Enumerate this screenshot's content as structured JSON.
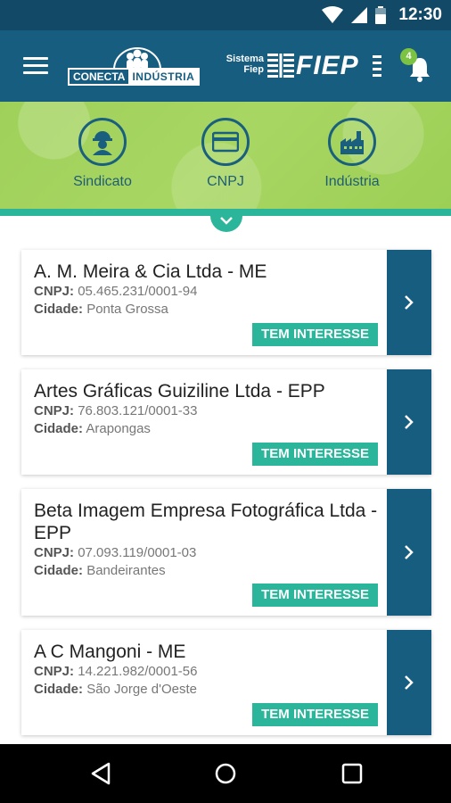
{
  "status_bar": {
    "time": "12:30"
  },
  "header": {
    "logo_conecta_left": "CONECTA",
    "logo_conecta_right": "INDÚSTRIA",
    "logo_sistema": "Sistema",
    "logo_fiep_small": "Fiep",
    "logo_fiep": "FIEP",
    "notification_count": "4"
  },
  "shortcuts": [
    {
      "label": "Sindicato",
      "icon": "worker-helmet-icon"
    },
    {
      "label": "CNPJ",
      "icon": "card-icon"
    },
    {
      "label": "Indústria",
      "icon": "factory-icon"
    }
  ],
  "list": {
    "cnpj_label": "CNPJ:",
    "city_label": "Cidade:",
    "interest_label": "TEM INTERESSE",
    "items": [
      {
        "name": "A. M. Meira & Cia Ltda - ME",
        "cnpj": "05.465.231/0001-94",
        "city": "Ponta Grossa"
      },
      {
        "name": "Artes Gráficas Guiziline Ltda - EPP",
        "cnpj": "76.803.121/0001-33",
        "city": "Arapongas"
      },
      {
        "name": "Beta Imagem Empresa Fotográfica Ltda - EPP",
        "cnpj": "07.093.119/0001-03",
        "city": "Bandeirantes"
      },
      {
        "name": "A C Mangoni - ME",
        "cnpj": "14.221.982/0001-56",
        "city": "São Jorge d'Oeste"
      }
    ]
  },
  "colors": {
    "primary": "#175d80",
    "accent": "#2bb59a",
    "banner": "#a8d663",
    "badge": "#7cc243"
  }
}
